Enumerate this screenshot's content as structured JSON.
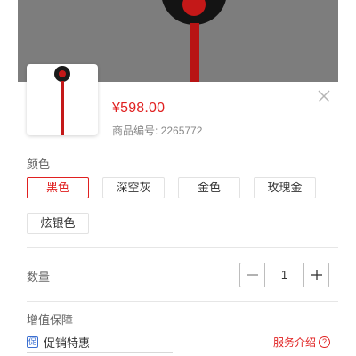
{
  "product": {
    "price": "¥598.00",
    "sku_label": "商品编号: 2265772"
  },
  "color_section": {
    "label": "颜色",
    "options": [
      {
        "label": "黑色",
        "selected": true
      },
      {
        "label": "深空灰",
        "selected": false
      },
      {
        "label": "金色",
        "selected": false
      },
      {
        "label": "玫瑰金",
        "selected": false
      },
      {
        "label": "炫银色",
        "selected": false
      }
    ]
  },
  "quantity_section": {
    "label": "数量",
    "value": "1",
    "minus_icon": "minus-icon",
    "plus_icon": "plus-icon"
  },
  "service_section": {
    "label": "增值保障",
    "item_label": "促销特惠",
    "item_icon_glyph": "促",
    "link_label": "服务介绍",
    "link_icon_glyph": "?"
  },
  "colors": {
    "accent": "#e02020",
    "divider": "#e6e6e6",
    "backdrop": "#7d7d7d"
  }
}
